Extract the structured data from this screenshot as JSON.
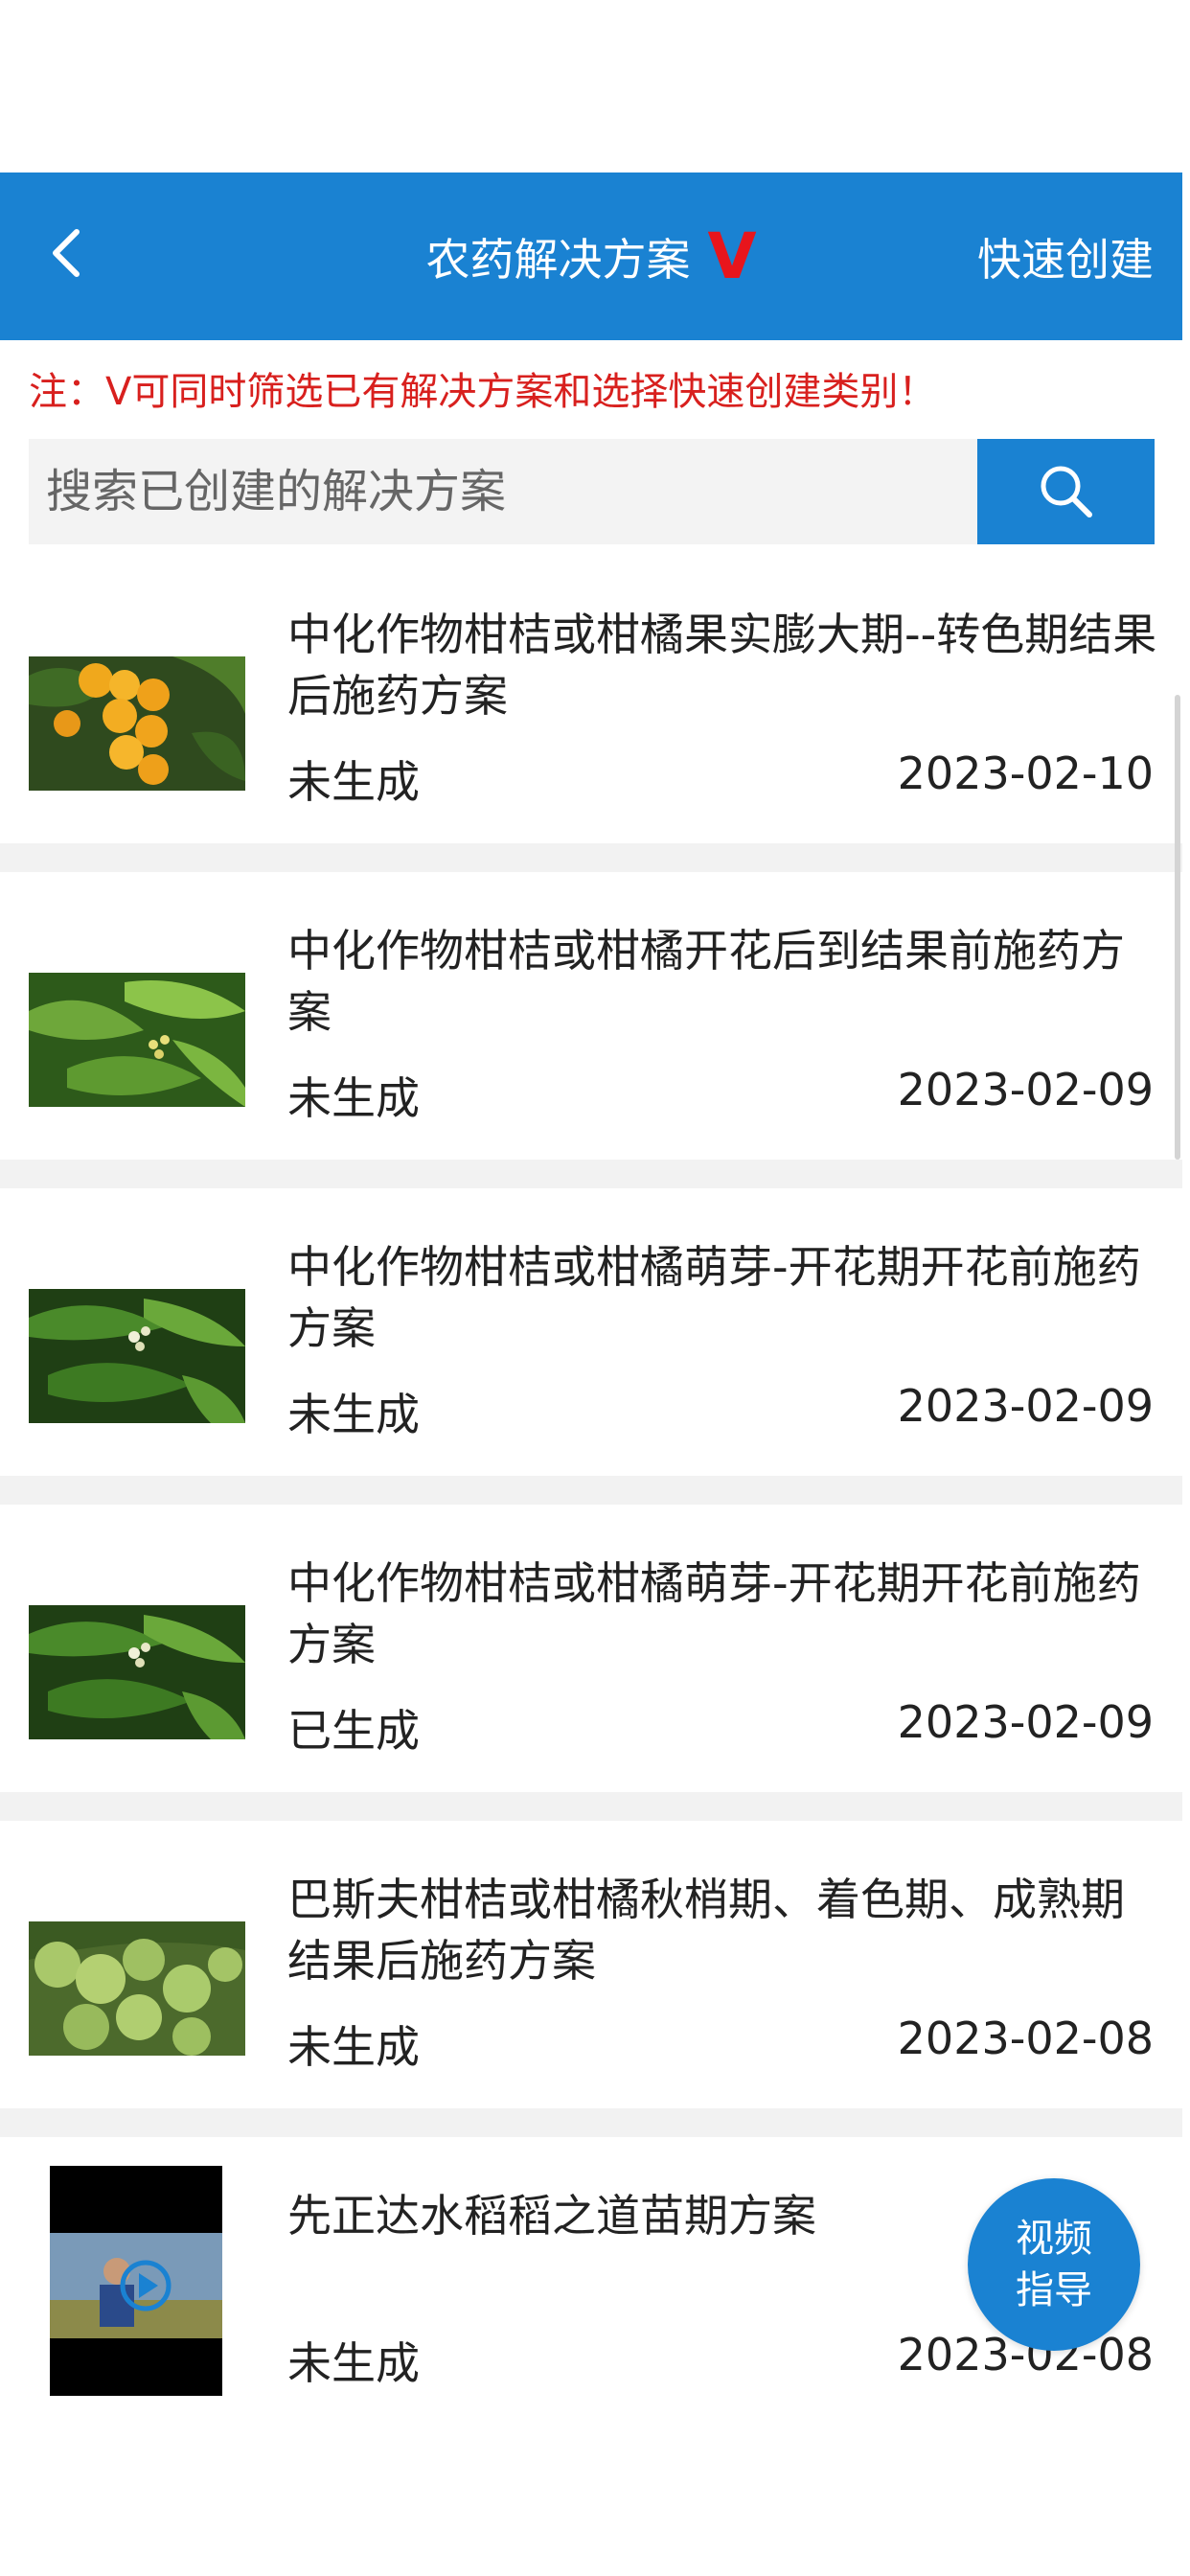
{
  "header": {
    "title": "农药解决方案",
    "filter_label": "V",
    "quick_create_label": "快速创建"
  },
  "note": "注：V可同时筛选已有解决方案和选择快速创建类别！",
  "search": {
    "placeholder": "搜索已创建的解决方案",
    "value": ""
  },
  "items": [
    {
      "title": "中化作物柑桔或柑橘果实膨大期--转色期结果后施药方案",
      "status": "未生成",
      "date": "2023-02-10",
      "thumbnail": "citrus-fruit-image"
    },
    {
      "title": "中化作物柑桔或柑橘开花后到结果前施药方案",
      "status": "未生成",
      "date": "2023-02-09",
      "thumbnail": "citrus-leaves-image"
    },
    {
      "title": "中化作物柑桔或柑橘萌芽-开花期开花前施药方案",
      "status": "未生成",
      "date": "2023-02-09",
      "thumbnail": "citrus-buds-image"
    },
    {
      "title": "中化作物柑桔或柑橘萌芽-开花期开花前施药方案",
      "status": "已生成",
      "date": "2023-02-09",
      "thumbnail": "citrus-buds-image"
    },
    {
      "title": "巴斯夫柑桔或柑橘秋梢期、着色期、成熟期结果后施药方案",
      "status": "未生成",
      "date": "2023-02-08",
      "thumbnail": "green-citrus-fruit-image"
    },
    {
      "title": "先正达水稻稻之道苗期方案",
      "status": "未生成",
      "date": "2023-02-08",
      "thumbnail": "video-thumbnail"
    }
  ],
  "float_button": {
    "line1": "视频",
    "line2": "指导"
  },
  "colors": {
    "primary": "#1a82d2",
    "accent_red": "#e8151c",
    "divider": "#f2f2f2"
  }
}
